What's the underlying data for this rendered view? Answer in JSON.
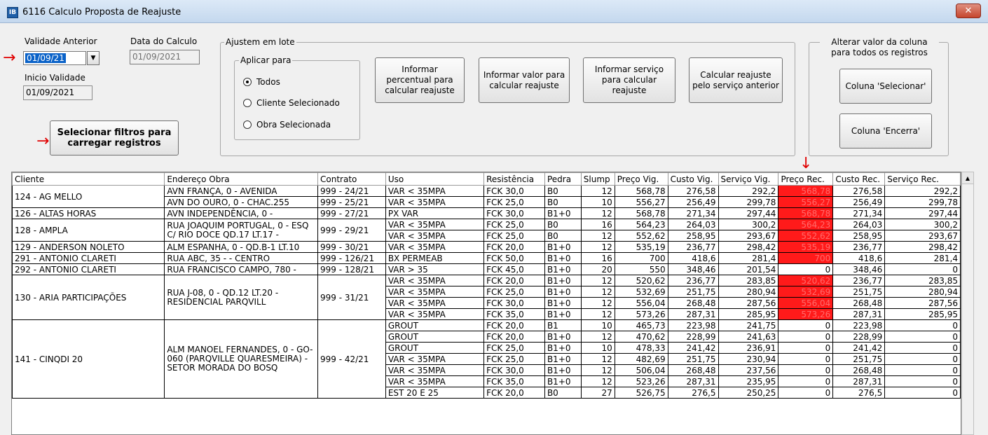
{
  "window": {
    "icon_text": "IB",
    "title": "6116 Calculo Proposta de Reajuste",
    "close": "✕"
  },
  "validade": {
    "label": "Validade Anterior",
    "value": "01/09/21",
    "arrow": "→"
  },
  "data_calculo": {
    "label": "Data do Calculo",
    "value": "01/09/2021"
  },
  "inicio": {
    "label": "Inicio Validade",
    "value": "01/09/2021"
  },
  "load_button": {
    "label": "Selecionar filtros para carregar registros",
    "arrow": "→"
  },
  "lote": {
    "title": "Ajustem em lote",
    "aplicar_title": "Aplicar para",
    "options": [
      "Todos",
      "Cliente Selecionado",
      "Obra Selecionada"
    ],
    "selected": 0,
    "buttons": [
      "Informar percentual para calcular reajuste",
      "Informar valor para calcular reajuste",
      "Informar serviço para calcular reajuste",
      "Calcular reajuste pelo serviço anterior"
    ]
  },
  "alterar": {
    "title": "Alterar valor da coluna para todos os registros",
    "buttons": [
      "Coluna 'Selecionar'",
      "Coluna 'Encerra'"
    ]
  },
  "column_arrow": "↓",
  "highlight_color": "#ff1a1a",
  "grid": {
    "columns": [
      "Cliente",
      "Endereço Obra",
      "Contrato",
      "Uso",
      "Resistência",
      "Pedra",
      "Slump",
      "Preço Vig.",
      "Custo Vig.",
      "Serviço Vig.",
      "Preço Rec.",
      "Custo Rec.",
      "Serviço Rec."
    ],
    "rows": [
      [
        "124 - AG MELLO",
        "AVN FRANÇA, 0 - AVENIDA",
        "999 - 24/21",
        "VAR < 35MPA",
        "FCK 30,0",
        "B0",
        "12",
        "568,78",
        "276,58",
        "292,2",
        "568,78",
        "276,58",
        "292,2"
      ],
      [
        "",
        "AVN DO OURO, 0 - CHAC.255",
        "999 - 25/21",
        "VAR < 35MPA",
        "FCK 25,0",
        "B0",
        "10",
        "556,27",
        "256,49",
        "299,78",
        "556,27",
        "256,49",
        "299,78"
      ],
      [
        "126 - ALTAS HORAS",
        "AVN INDEPENDÊNCIA, 0 -",
        "999 - 27/21",
        "PX VAR",
        "FCK 30,0",
        "B1+0",
        "12",
        "568,78",
        "271,34",
        "297,44",
        "568,78",
        "271,34",
        "297,44"
      ],
      [
        "128 - AMPLA",
        "RUA JOAQUIM PORTUGAL, 0 - ESQ C/ RIO DOCE QD.17 LT.17 -",
        "999 - 29/21",
        "VAR < 35MPA",
        "FCK 25,0",
        "B0",
        "16",
        "564,23",
        "264,03",
        "300,2",
        "564,23",
        "264,03",
        "300,2"
      ],
      [
        "",
        "",
        "",
        "VAR < 35MPA",
        "FCK 25,0",
        "B0",
        "12",
        "552,62",
        "258,95",
        "293,67",
        "552,62",
        "258,95",
        "293,67"
      ],
      [
        "129 - ANDERSON NOLETO",
        "ALM ESPANHA, 0 - QD.B-1 LT.10",
        "999 - 30/21",
        "VAR < 35MPA",
        "FCK 20,0",
        "B1+0",
        "12",
        "535,19",
        "236,77",
        "298,42",
        "535,19",
        "236,77",
        "298,42"
      ],
      [
        "291 - ANTONIO CLARETI",
        "RUA ABC, 35 -  - CENTRO",
        "999 - 126/21",
        "BX PERMEAB",
        "FCK 50,0",
        "B1+0",
        "16",
        "700",
        "418,6",
        "281,4",
        "700",
        "418,6",
        "281,4"
      ],
      [
        "292 - ANTONIO CLARETI",
        "RUA FRANCISCO CAMPO, 780 -",
        "999 - 128/21",
        "VAR > 35",
        "FCK 45,0",
        "B1+0",
        "20",
        "550",
        "348,46",
        "201,54",
        "0",
        "348,46",
        "0"
      ],
      [
        "130 - ARIA PARTICIPAÇÕES",
        "RUA J-08, 0 - QD.12 LT.20 - RESIDENCIAL PARQVILL",
        "999 - 31/21",
        "VAR < 35MPA",
        "FCK 20,0",
        "B1+0",
        "12",
        "520,62",
        "236,77",
        "283,85",
        "520,62",
        "236,77",
        "283,85"
      ],
      [
        "",
        "",
        "",
        "VAR < 35MPA",
        "FCK 25,0",
        "B1+0",
        "12",
        "532,69",
        "251,75",
        "280,94",
        "532,69",
        "251,75",
        "280,94"
      ],
      [
        "",
        "",
        "",
        "VAR < 35MPA",
        "FCK 30,0",
        "B1+0",
        "12",
        "556,04",
        "268,48",
        "287,56",
        "556,04",
        "268,48",
        "287,56"
      ],
      [
        "",
        "",
        "",
        "VAR < 35MPA",
        "FCK 35,0",
        "B1+0",
        "12",
        "573,26",
        "287,31",
        "285,95",
        "573,26",
        "287,31",
        "285,95"
      ],
      [
        "141 - CINQDI 20",
        "ALM MANOEL FERNANDES, 0 - GO-060 (PARQVILLE QUARESMEIRA) - SETOR MORADA DO BOSQ",
        "999 - 42/21",
        "GROUT",
        "FCK 20,0",
        "B1",
        "10",
        "465,73",
        "223,98",
        "241,75",
        "0",
        "223,98",
        "0"
      ],
      [
        "",
        "",
        "",
        "GROUT",
        "FCK 20,0",
        "B1+0",
        "12",
        "470,62",
        "228,99",
        "241,63",
        "0",
        "228,99",
        "0"
      ],
      [
        "",
        "",
        "",
        "GROUT",
        "FCK 25,0",
        "B1+0",
        "10",
        "478,33",
        "241,42",
        "236,91",
        "0",
        "241,42",
        "0"
      ],
      [
        "",
        "",
        "",
        "VAR < 35MPA",
        "FCK 25,0",
        "B1+0",
        "12",
        "482,69",
        "251,75",
        "230,94",
        "0",
        "251,75",
        "0"
      ],
      [
        "",
        "",
        "",
        "VAR < 35MPA",
        "FCK 30,0",
        "B1+0",
        "12",
        "506,04",
        "268,48",
        "237,56",
        "0",
        "268,48",
        "0"
      ],
      [
        "",
        "",
        "",
        "VAR < 35MPA",
        "FCK 35,0",
        "B1+0",
        "12",
        "523,26",
        "287,31",
        "235,95",
        "0",
        "287,31",
        "0"
      ],
      [
        "",
        "",
        "",
        "EST 20 E 25",
        "FCK 20,0",
        "B0",
        "27",
        "526,75",
        "276,5",
        "250,25",
        "0",
        "276,5",
        "0"
      ]
    ],
    "highlighted_rows": [
      0,
      1,
      2,
      3,
      4,
      5,
      6,
      8,
      9,
      10,
      11
    ]
  }
}
